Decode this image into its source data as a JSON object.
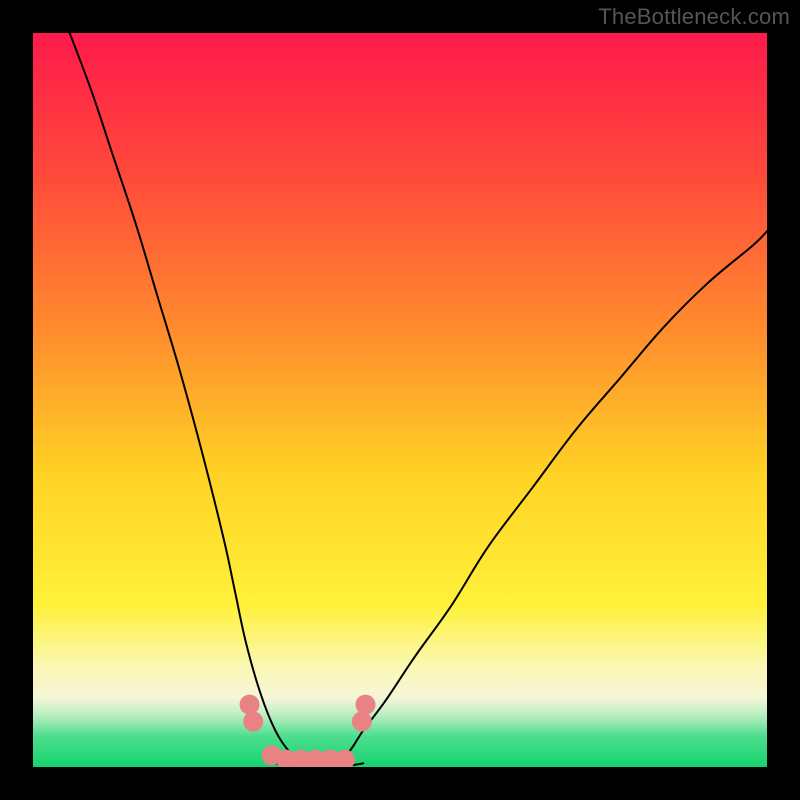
{
  "watermark": "TheBottleneck.com",
  "chart_data": {
    "type": "line",
    "title": "",
    "xlabel": "",
    "ylabel": "",
    "xlim": [
      0,
      100
    ],
    "ylim": [
      0,
      100
    ],
    "grid": false,
    "legend": false,
    "gradient_stops": [
      {
        "offset": 0.0,
        "color": "#ff1a4b"
      },
      {
        "offset": 0.2,
        "color": "#ff4b3a"
      },
      {
        "offset": 0.4,
        "color": "#ff8a2e"
      },
      {
        "offset": 0.6,
        "color": "#ffd224"
      },
      {
        "offset": 0.78,
        "color": "#fff13a"
      },
      {
        "offset": 0.86,
        "color": "#fbf7b0"
      },
      {
        "offset": 0.905,
        "color": "#f6f6d9"
      },
      {
        "offset": 0.93,
        "color": "#b9eec0"
      },
      {
        "offset": 0.958,
        "color": "#4dde8e"
      },
      {
        "offset": 1.0,
        "color": "#15d46f"
      }
    ],
    "series": [
      {
        "name": "left-arm",
        "x": [
          5,
          8,
          11,
          14,
          17,
          20,
          23,
          26,
          27.5,
          29,
          31,
          33,
          35,
          37
        ],
        "y": [
          100,
          92,
          83,
          74,
          64,
          54,
          43,
          31,
          24,
          17,
          10,
          5,
          2,
          0.5
        ]
      },
      {
        "name": "right-arm",
        "x": [
          41,
          43,
          45,
          48,
          52,
          57,
          62,
          68,
          74,
          80,
          86,
          92,
          98,
          100
        ],
        "y": [
          0.5,
          2,
          5,
          9,
          15,
          22,
          30,
          38,
          46,
          53,
          60,
          66,
          71,
          73
        ]
      },
      {
        "name": "valley-floor",
        "x": [
          33,
          35,
          37,
          39,
          41,
          43,
          45
        ],
        "y": [
          0.5,
          0.2,
          0.2,
          0.2,
          0.2,
          0.2,
          0.5
        ]
      }
    ],
    "markers": {
      "name": "valley-dots",
      "x": [
        29.5,
        30,
        32.5,
        34.5,
        36.5,
        38.5,
        40.5,
        42.5,
        44.8,
        45.3
      ],
      "y": [
        8.5,
        6.2,
        1.6,
        1.0,
        1.0,
        1.0,
        1.0,
        1.0,
        6.2,
        8.5
      ],
      "color": "#e98383",
      "size": 10
    }
  }
}
